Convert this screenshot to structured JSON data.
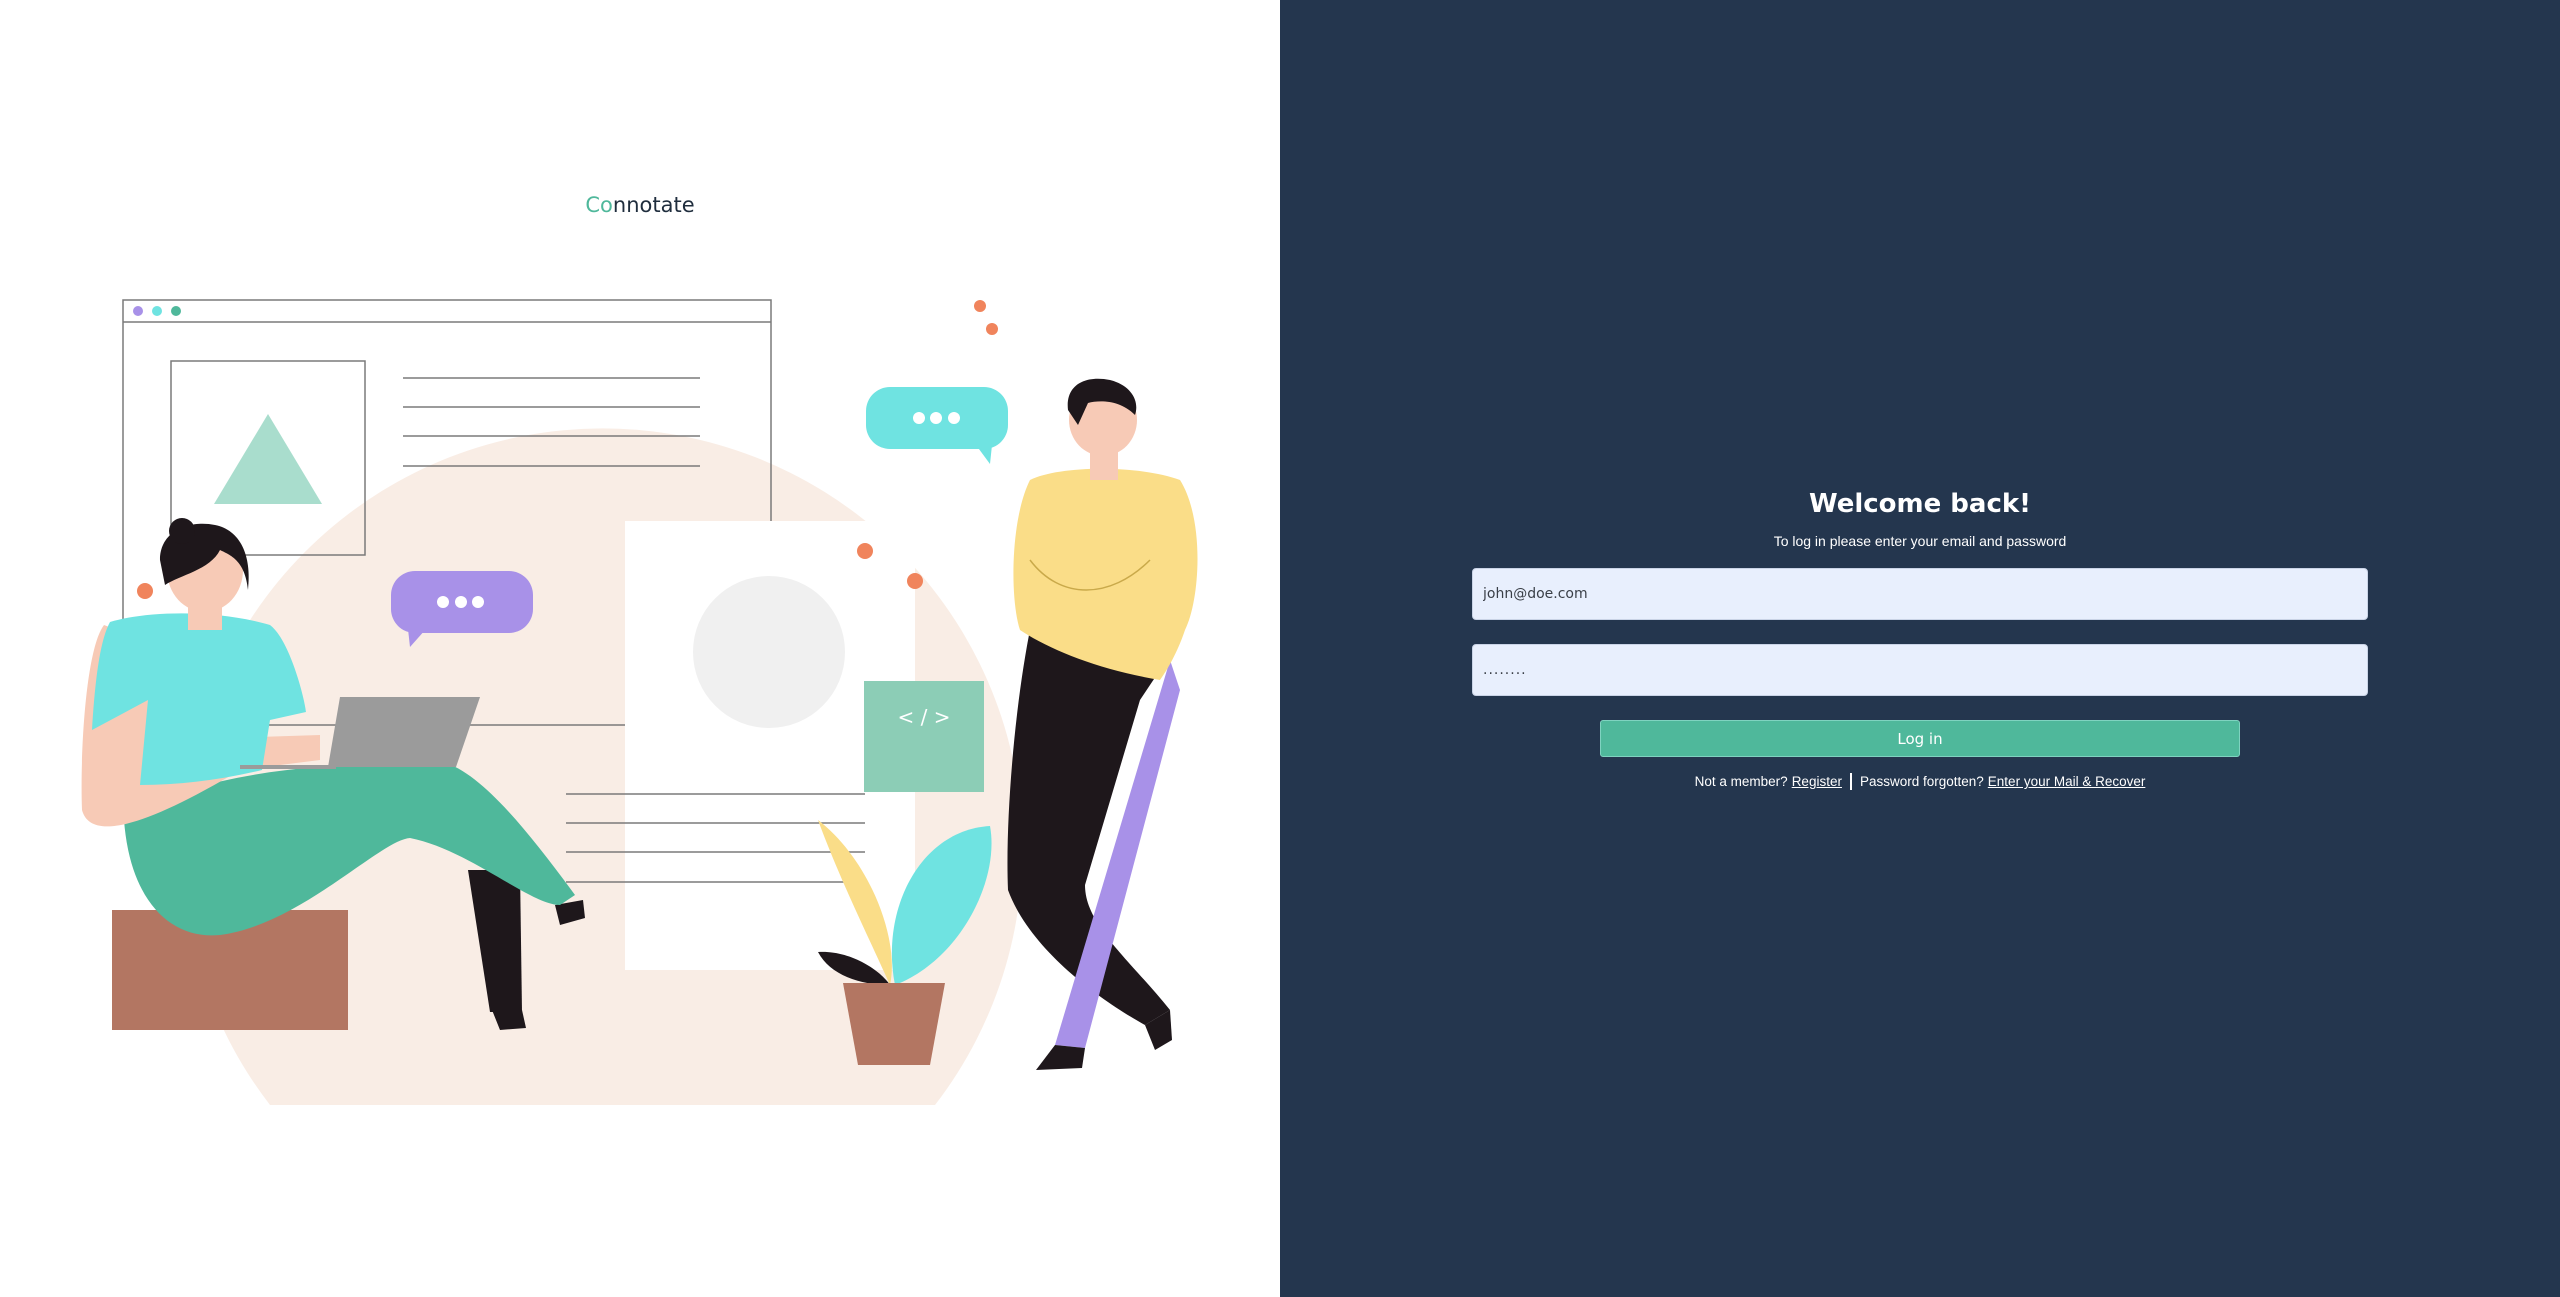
{
  "brand": {
    "prefix": "Co",
    "rest": "nnotate",
    "accent_color": "#4fb89b"
  },
  "illustration": {
    "code_tag": "< / >",
    "icons": [
      "browser-window-icon",
      "chat-bubble-icon",
      "code-icon",
      "plant-icon"
    ]
  },
  "form": {
    "heading": "Welcome back!",
    "subtitle": "To log in please enter your email and password",
    "email": {
      "value": "john@doe.com",
      "placeholder": "john@doe.com"
    },
    "password": {
      "value": "........"
    },
    "login_label": "Log in"
  },
  "links": {
    "not_member": "Not a member?",
    "register": "Register",
    "forgot": "Password forgotten?",
    "recover": "Enter your Mail & Recover"
  },
  "colors": {
    "left_bg": "#ffffff",
    "right_bg": "#24364e",
    "input_bg": "#e8effd",
    "button_bg": "#4fb89b"
  }
}
